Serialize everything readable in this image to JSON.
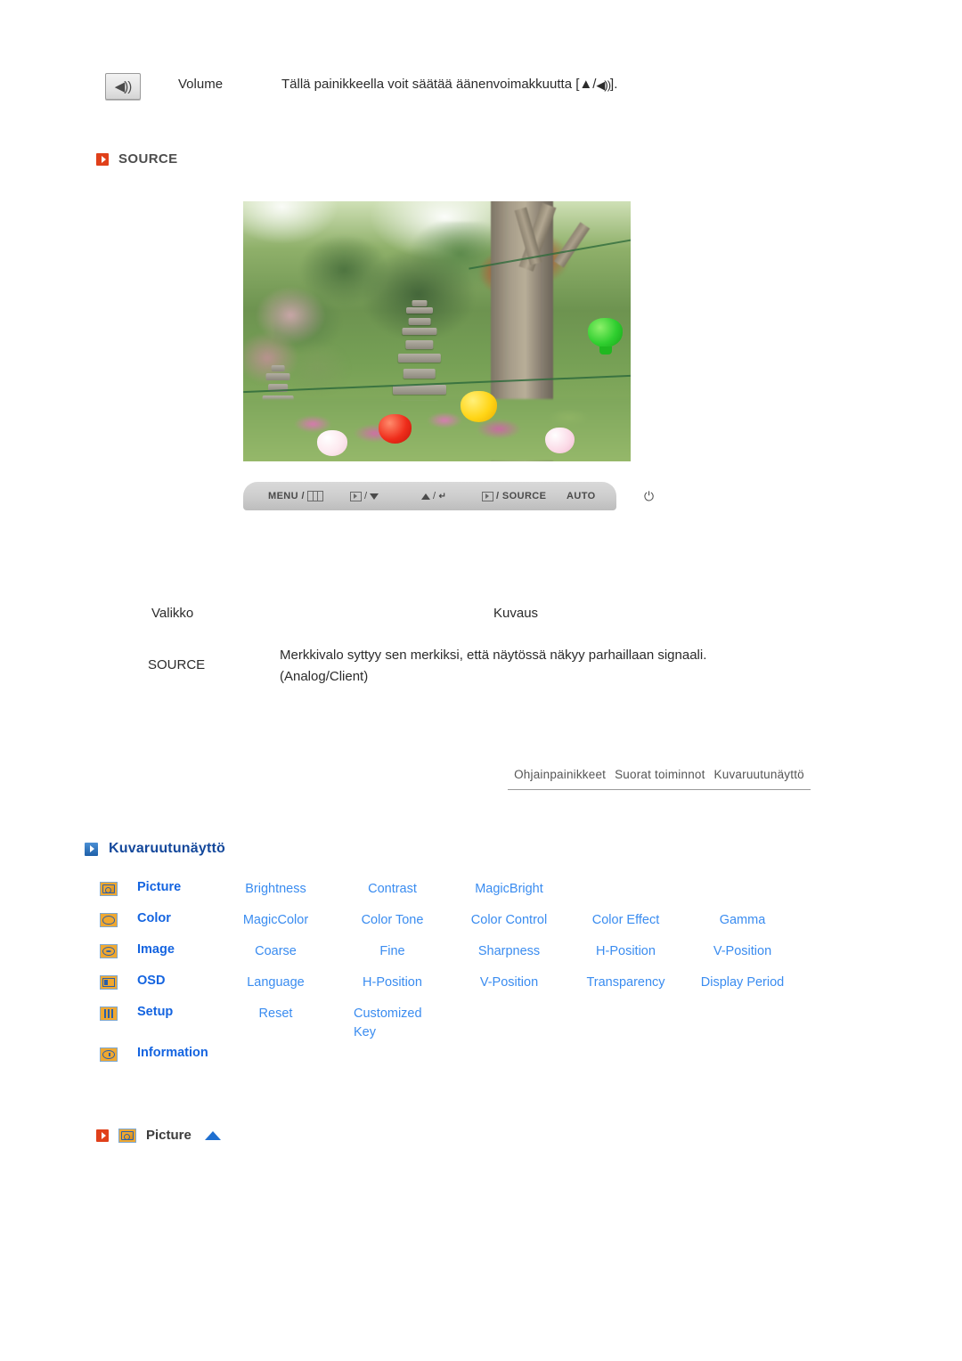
{
  "volume_row": {
    "icon": "speaker-icon",
    "label": "Volume",
    "description": "Tällä painikkeella voit säätää äänenvoimakkuutta [▲/",
    "description_tail": "]."
  },
  "source_section": {
    "heading": "SOURCE",
    "photo_alt": "Korean garden with stone pagodas and paper lanterns",
    "control_bar": {
      "items": [
        {
          "name": "menu-button",
          "label": "MENU /",
          "glyph": "osd-grid-icon"
        },
        {
          "name": "enter-down-button",
          "label": "/",
          "glyph_left": "enter-icon",
          "glyph_right": "triangle-down-icon"
        },
        {
          "name": "up-return-button",
          "label": "/",
          "glyph_left": "triangle-up-icon",
          "glyph_right": "return-icon"
        },
        {
          "name": "source-button",
          "label": "/ SOURCE",
          "glyph_left": "enter-icon"
        },
        {
          "name": "auto-button",
          "label": "AUTO"
        },
        {
          "name": "power-button",
          "label": "",
          "glyph": "power-icon"
        }
      ]
    }
  },
  "description_table": {
    "headers": {
      "menu": "Valikko",
      "description": "Kuvaus"
    },
    "rows": [
      {
        "menu": "SOURCE",
        "description_line1": "Merkkivalo syttyy sen merkiksi, että näytössä näkyy parhaillaan signaali.",
        "description_line2": "(Analog/Client)"
      }
    ]
  },
  "breadcrumb": {
    "items": [
      "Ohjainpainikkeet",
      "Suorat toiminnot",
      "Kuvaruutunäyttö"
    ]
  },
  "osd_section": {
    "heading": "Kuvaruutunäyttö",
    "rows": [
      {
        "icon": "picture-icon",
        "category": "Picture",
        "items": [
          "Brightness",
          "Contrast",
          "MagicBright"
        ]
      },
      {
        "icon": "color-icon",
        "category": "Color",
        "items": [
          "MagicColor",
          "Color Tone",
          "Color Control",
          "Color Effect",
          "Gamma"
        ]
      },
      {
        "icon": "image-icon",
        "category": "Image",
        "items": [
          "Coarse",
          "Fine",
          "Sharpness",
          "H-Position",
          "V-Position"
        ]
      },
      {
        "icon": "osd-icon",
        "category": "OSD",
        "items": [
          "Language",
          "H-Position",
          "V-Position",
          "Transparency",
          "Display Period"
        ]
      },
      {
        "icon": "setup-icon",
        "category": "Setup",
        "items": [
          "Reset",
          "Customized Key"
        ]
      },
      {
        "icon": "information-icon",
        "category": "Information",
        "items": []
      }
    ]
  },
  "picture_footer": {
    "bullet": "orange-arrow-icon",
    "icon": "picture-icon",
    "label": "Picture",
    "scroll_top": "blue-up-triangle-icon"
  },
  "colors": {
    "accent_orange": "#e0401a",
    "accent_blue": "#14489b",
    "link_blue": "#3a8cf0",
    "category_blue": "#1464e0",
    "icon_orange": "#f0a830"
  }
}
